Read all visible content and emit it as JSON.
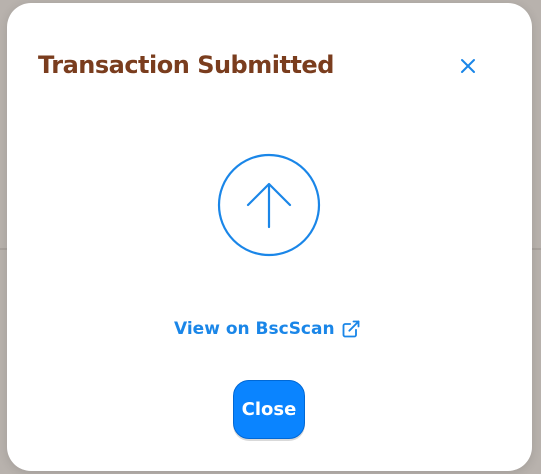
{
  "modal": {
    "title": "Transaction Submitted",
    "close_icon": "close-icon",
    "status_icon": "arrow-up-circle-icon",
    "explorer_link": {
      "label": "View on BscScan",
      "icon": "external-link-icon"
    },
    "close_button_label": "Close"
  },
  "colors": {
    "title": "#7a3d1e",
    "accent": "#1a86e8",
    "button_bg": "#0a84ff",
    "button_text": "#ffffff",
    "modal_bg": "#ffffff",
    "backdrop": "#b8b2ad"
  }
}
